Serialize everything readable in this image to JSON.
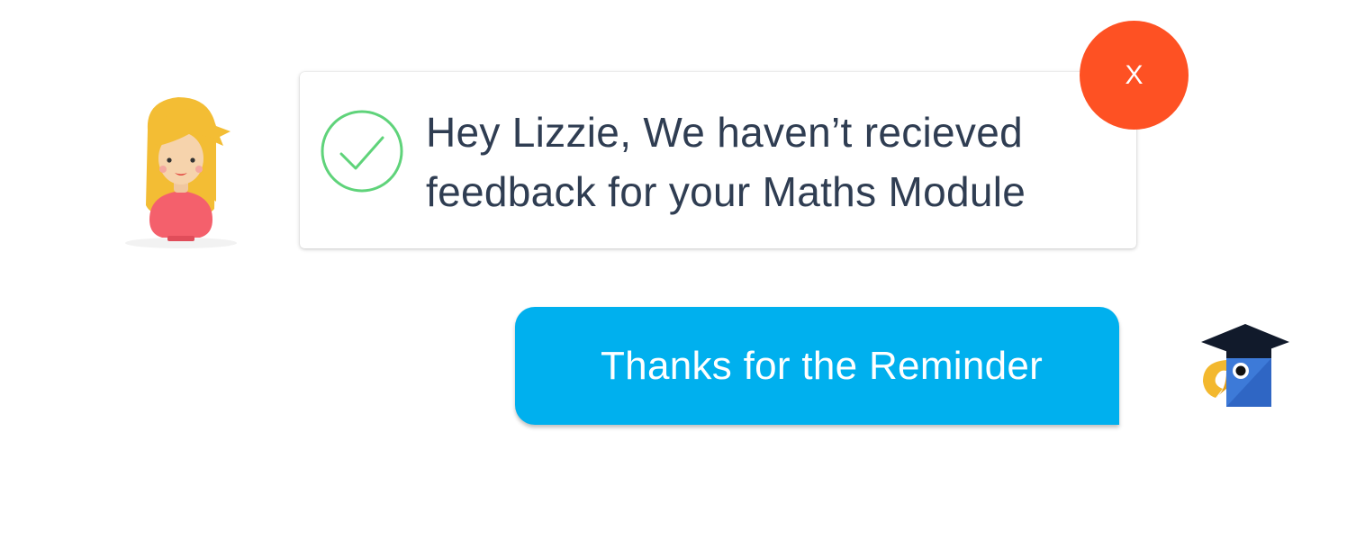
{
  "notification": {
    "message_line1": "Hey Lizzie, We haven’t recieved",
    "message_line2": "feedback for your Maths Module",
    "close_label": "X"
  },
  "reply": {
    "button_label": "Thanks for the Reminder"
  },
  "icons": {
    "user_avatar": "girl-avatar-icon",
    "status": "checkmark-circle-icon",
    "bot": "parrot-graduation-cap-icon"
  },
  "colors": {
    "close_button": "#fe5123",
    "reply_button": "#00b0ee",
    "check_green": "#5fd37a",
    "text_dark": "#2f3d52"
  }
}
